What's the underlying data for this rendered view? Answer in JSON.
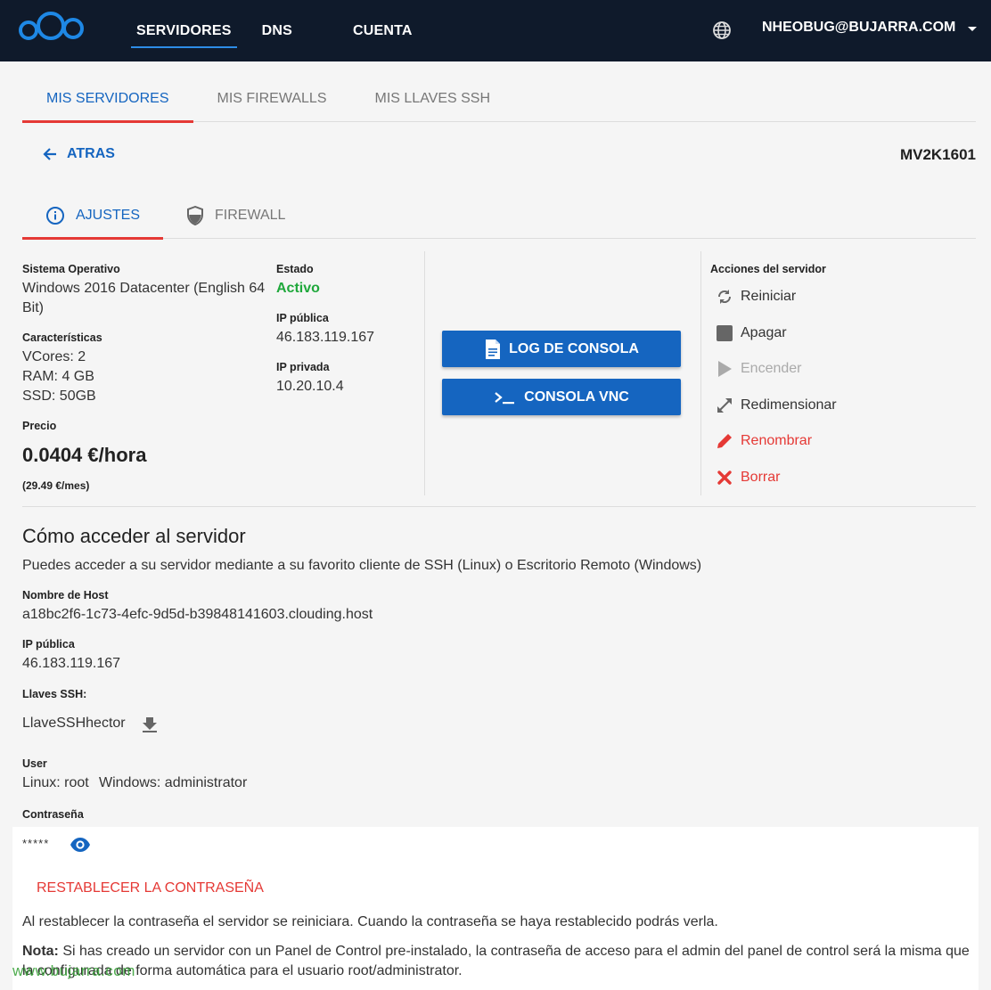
{
  "topbar": {
    "nav": [
      "SERVIDORES",
      "DNS",
      "CUENTA"
    ],
    "user": "NHEOBUG@BUJARRA.COM"
  },
  "subtabs": [
    "MIS SERVIDORES",
    "MIS FIREWALLS",
    "MIS LLAVES SSH"
  ],
  "back_label": "ATRAS",
  "server_name": "MV2K1601",
  "tabs": [
    "AJUSTES",
    "FIREWALL"
  ],
  "settings": {
    "os_label": "Sistema Operativo",
    "os_line1": "Windows 2016 Datacenter (English 64",
    "os_line2": "Bit)",
    "specs_label": "Características",
    "vcores": "VCores: 2",
    "ram": "RAM: 4 GB",
    "ssd": "SSD: 50GB",
    "price_label": "Precio",
    "price": "0.0404 €/hora",
    "price_month": "(29.49 €/mes)",
    "status_label": "Estado",
    "status": "Activo",
    "public_ip_label": "IP pública",
    "public_ip": "46.183.119.167",
    "private_ip_label": "IP privada",
    "private_ip": "10.20.10.4"
  },
  "buttons": {
    "log": "LOG DE CONSOLA",
    "vnc": "CONSOLA VNC"
  },
  "actions": {
    "title": "Acciones del servidor",
    "restart": "Reiniciar",
    "shutdown": "Apagar",
    "power_on": "Encender",
    "resize": "Redimensionar",
    "rename": "Renombrar",
    "delete": "Borrar"
  },
  "access": {
    "title": "Cómo acceder al servidor",
    "desc": "Puedes acceder a su servidor mediante a su favorito cliente de SSH (Linux) o Escritorio Remoto (Windows)",
    "host_label": "Nombre de Host",
    "host": "a18bc2f6-1c73-4efc-9d5d-b39848141603.clouding.host",
    "ip_label": "IP pública",
    "ip": "46.183.119.167",
    "ssh_label": "Llaves SSH:",
    "ssh_key": "LlaveSSHhector",
    "user_label": "User",
    "user_linux": "Linux: root",
    "user_windows": "Windows: administrator",
    "password_label": "Contraseña",
    "password": "*****",
    "reset_link": "RESTABLECER LA CONTRASEÑA",
    "reset_info": "Al restablecer la contraseña el servidor se reiniciara. Cuando la contraseña se haya restablecido podrás verla.",
    "note_bold": "Nota:",
    "note_line1": " Si has creado un servidor con un Panel de Control pre-instalado, la contraseña de acceso para el admin del panel de control será la misma que",
    "note_line2": "la configurada de forma automática para el usuario root/administrator."
  },
  "watermark": "www.bujarra.com",
  "colors": {
    "topbar": "#0f1a2b",
    "primary": "#1565c0",
    "danger": "#e53935",
    "active": "#1fa83b"
  }
}
